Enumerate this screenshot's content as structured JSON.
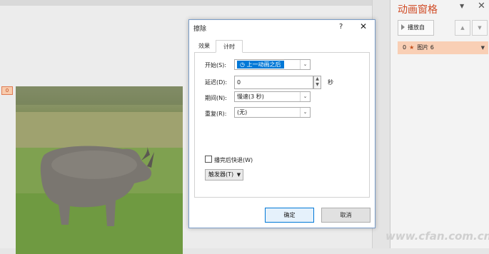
{
  "slide": {
    "animation_tag": "0"
  },
  "pane": {
    "title": "动画窗格",
    "dropdown_icon": "chevron-down-icon",
    "close_icon": "close-icon",
    "play_label": "播放自",
    "anim_item": {
      "index": "0",
      "name": "图片 6"
    }
  },
  "dialog": {
    "title": "擦除",
    "help": "?",
    "close": "✕",
    "tabs": [
      "效果",
      "计时"
    ],
    "active_tab": "计时",
    "start_label": "开始(S):",
    "start_value": "上一动画之后",
    "delay_label": "延迟(D):",
    "delay_value": "0",
    "delay_unit": "秒",
    "duration_label": "期间(N):",
    "duration_value": "慢速(3 秒)",
    "repeat_label": "重复(R):",
    "repeat_value": "(无)",
    "rewind_label": "播完后快退(W)",
    "rewind_checked": false,
    "trigger_label": "触发器(T)",
    "ok_label": "确定",
    "cancel_label": "取消"
  },
  "watermark": "www.cfan.com.cn",
  "colors": {
    "accent": "#d04a24",
    "selection": "#0078d7",
    "anim_row": "#f9cfb5"
  }
}
